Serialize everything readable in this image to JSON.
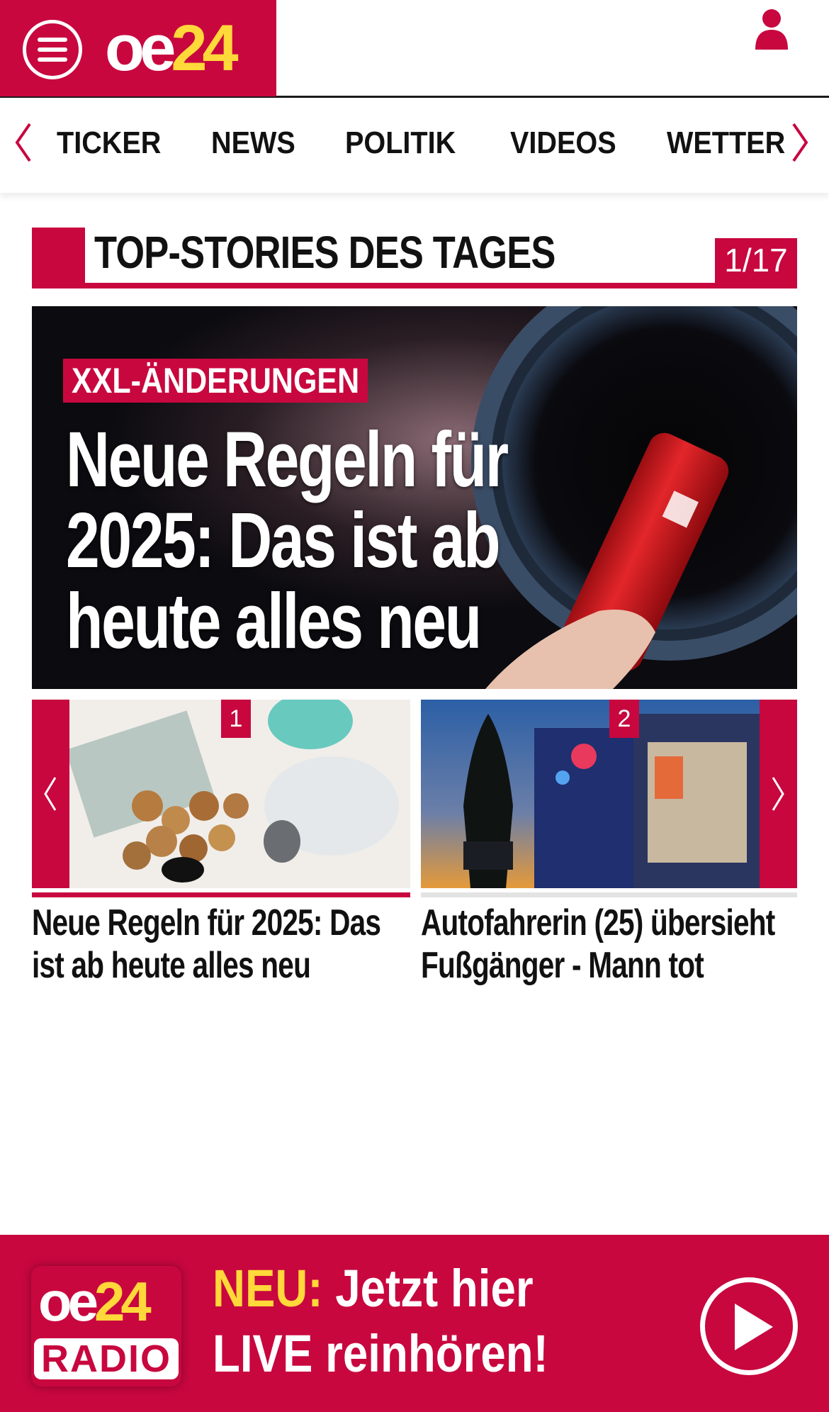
{
  "header": {
    "logo_oe": "oe",
    "logo_num": "24",
    "menu_icon": "hamburger-icon",
    "user_icon": "user-icon"
  },
  "nav": {
    "items": [
      "TICKER",
      "NEWS",
      "POLITIK",
      "VIDEOS",
      "WETTER"
    ],
    "left_arrow_icon": "chevron-left-icon",
    "right_arrow_icon": "chevron-right-icon"
  },
  "section": {
    "title": "TOP-STORIES DES TAGES",
    "counter": "1/17"
  },
  "hero": {
    "kicker": "XXL-ÄNDERUNGEN",
    "title": "Neue Regeln für 2025: Das ist ab heute alles neu"
  },
  "carousel": {
    "items": [
      {
        "number": "1",
        "title": "Neue Regeln für 2025: Das ist ab heute alles neu"
      },
      {
        "number": "2",
        "title": "Autofahrerin (25) übersieht Fußgänger - Mann tot"
      }
    ]
  },
  "radio": {
    "logo_oe": "oe",
    "logo_num": "24",
    "logo_label": "RADIO",
    "neu": "NEU:",
    "line1_rest": " Jetzt hier",
    "line2": "LIVE reinhören!",
    "play_icon": "play-icon"
  },
  "colors": {
    "brand_red": "#c8073f",
    "brand_yellow": "#ffd83a"
  }
}
